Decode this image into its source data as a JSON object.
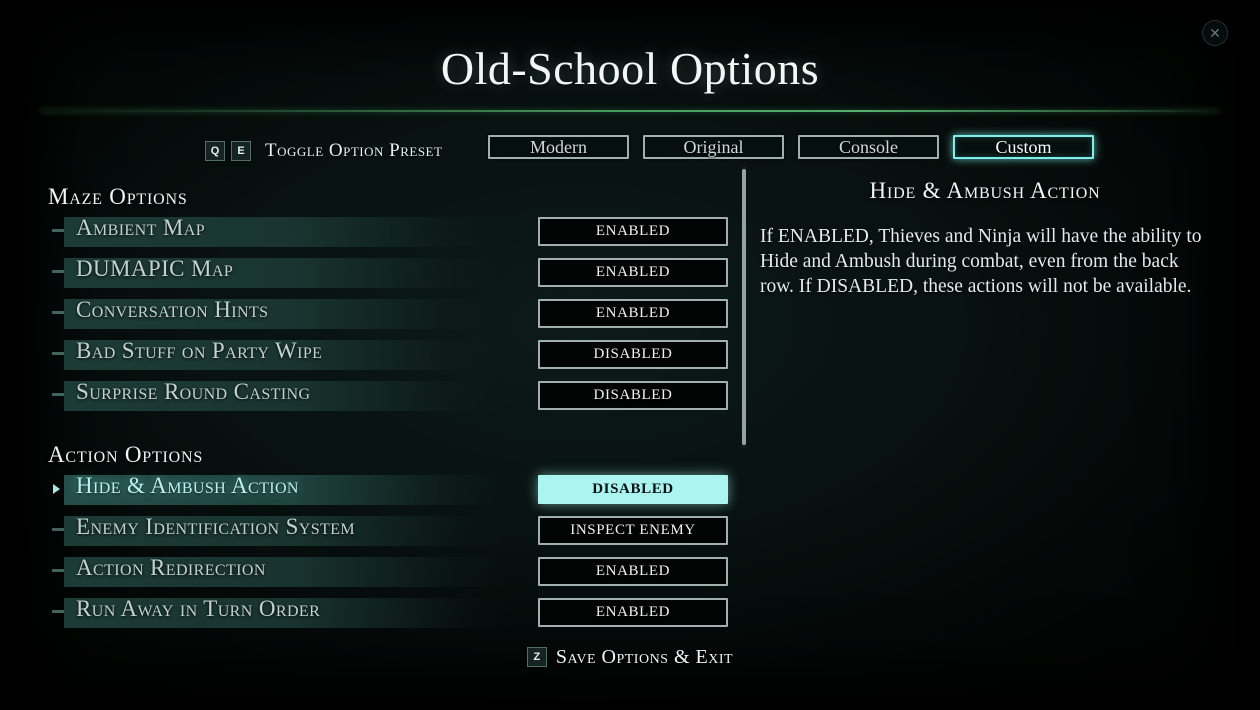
{
  "window": {
    "title": "Old-School Options",
    "close_label": "✕"
  },
  "preset": {
    "keys": [
      {
        "cap": "Q"
      },
      {
        "cap": "E"
      }
    ],
    "hint_label": "Toggle Option Preset",
    "options": [
      {
        "label": "Modern",
        "active": false
      },
      {
        "label": "Original",
        "active": false
      },
      {
        "label": "Console",
        "active": false
      },
      {
        "label": "Custom",
        "active": true
      }
    ],
    "selected": "Custom"
  },
  "sections": [
    {
      "heading": "Maze Options",
      "rows": [
        {
          "label": "Ambient Map",
          "value": "ENABLED",
          "selected": false
        },
        {
          "label": "DUMAPIC Map",
          "value": "ENABLED",
          "selected": false
        },
        {
          "label": "Conversation Hints",
          "value": "ENABLED",
          "selected": false
        },
        {
          "label": "Bad Stuff on Party Wipe",
          "value": "DISABLED",
          "selected": false
        },
        {
          "label": "Surprise Round Casting",
          "value": "DISABLED",
          "selected": false
        }
      ]
    },
    {
      "heading": "Action Options",
      "rows": [
        {
          "label": "Hide & Ambush Action",
          "value": "DISABLED",
          "selected": true
        },
        {
          "label": "Enemy Identification System",
          "value": "INSPECT ENEMY",
          "selected": false
        },
        {
          "label": "Action Redirection",
          "value": "ENABLED",
          "selected": false
        },
        {
          "label": "Run Away in Turn Order",
          "value": "ENABLED",
          "selected": false
        }
      ]
    }
  ],
  "description": {
    "title": "Hide & Ambush Action",
    "body": "If ENABLED, Thieves and Ninja will have the ability to Hide and Ambush during combat, even from the back row. If DISABLED, these actions will not be available."
  },
  "footer": {
    "key": "Z",
    "label": "Save Options & Exit"
  },
  "colors": {
    "accent_cyan": "#abf4f0",
    "divider_green": "#4ca060",
    "row_bar": "#1e3e3a",
    "text_primary": "#eef4f3",
    "text_dim": "#c3d2cf"
  }
}
